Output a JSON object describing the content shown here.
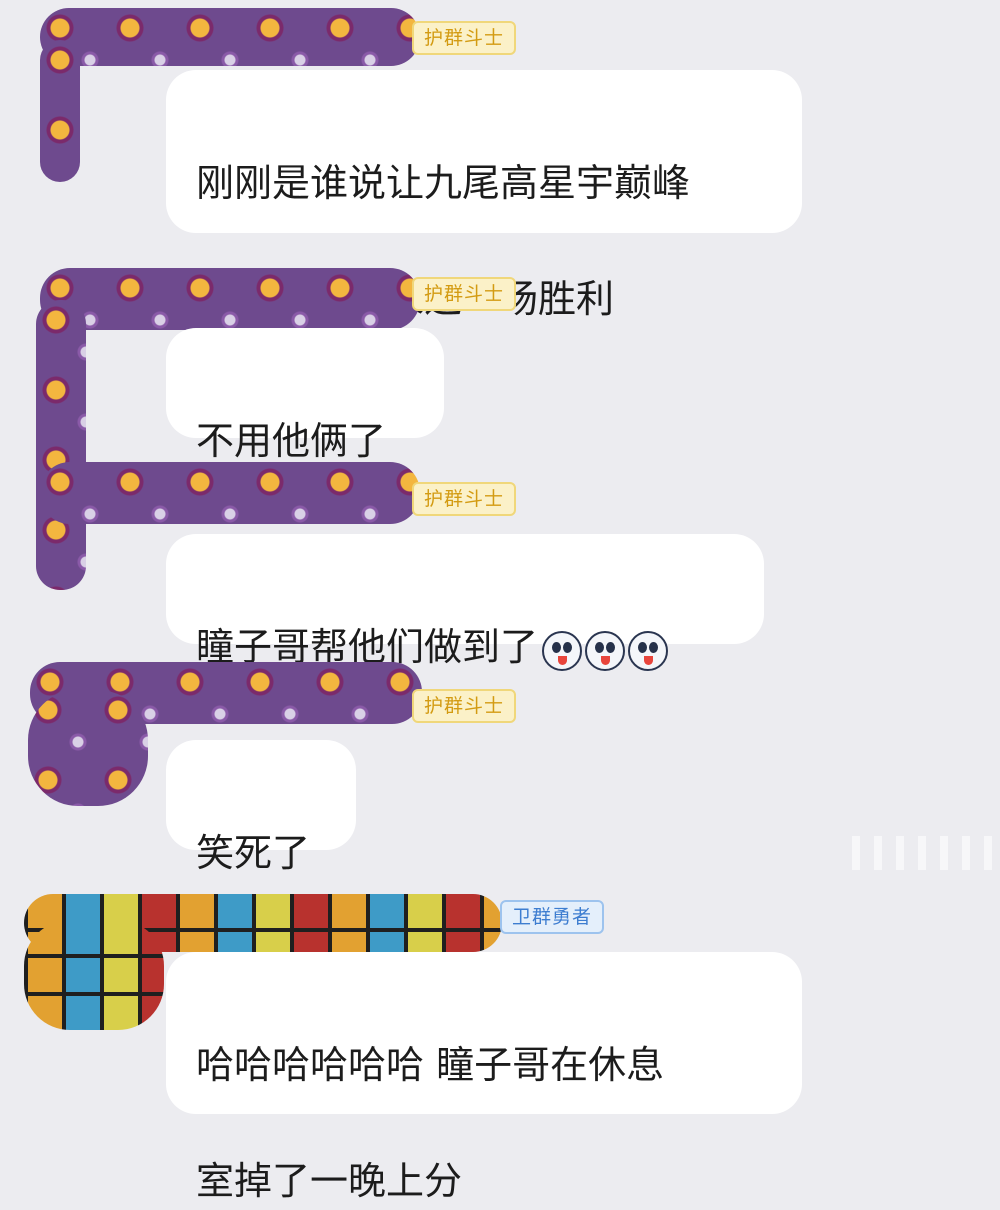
{
  "messages": [
    {
      "badge": "护群斗士",
      "lines": [
        "刚刚是谁说让九尾高星宇巅峰",
        "掉两百分换来这一场胜利"
      ]
    },
    {
      "badge": "护群斗士",
      "lines": [
        "不用他俩了"
      ]
    },
    {
      "badge": "护群斗士",
      "lines": [
        "瞳子哥帮他们做到了"
      ],
      "emoji_count": 3,
      "emoji_icon": "tongue-out-face-icon"
    },
    {
      "badge": "护群斗士",
      "lines": [
        "笑死了"
      ]
    },
    {
      "badge": "卫群勇者",
      "lines": [
        "哈哈哈哈哈哈 瞳子哥在休息",
        "室掉了一晚上分"
      ]
    }
  ],
  "colors": {
    "background": "#ececf0",
    "bubble": "#ffffff",
    "badge_gold_text": "#d39b12",
    "badge_blue_text": "#3d7dd0",
    "redaction_purple": "#6e4a8e"
  }
}
